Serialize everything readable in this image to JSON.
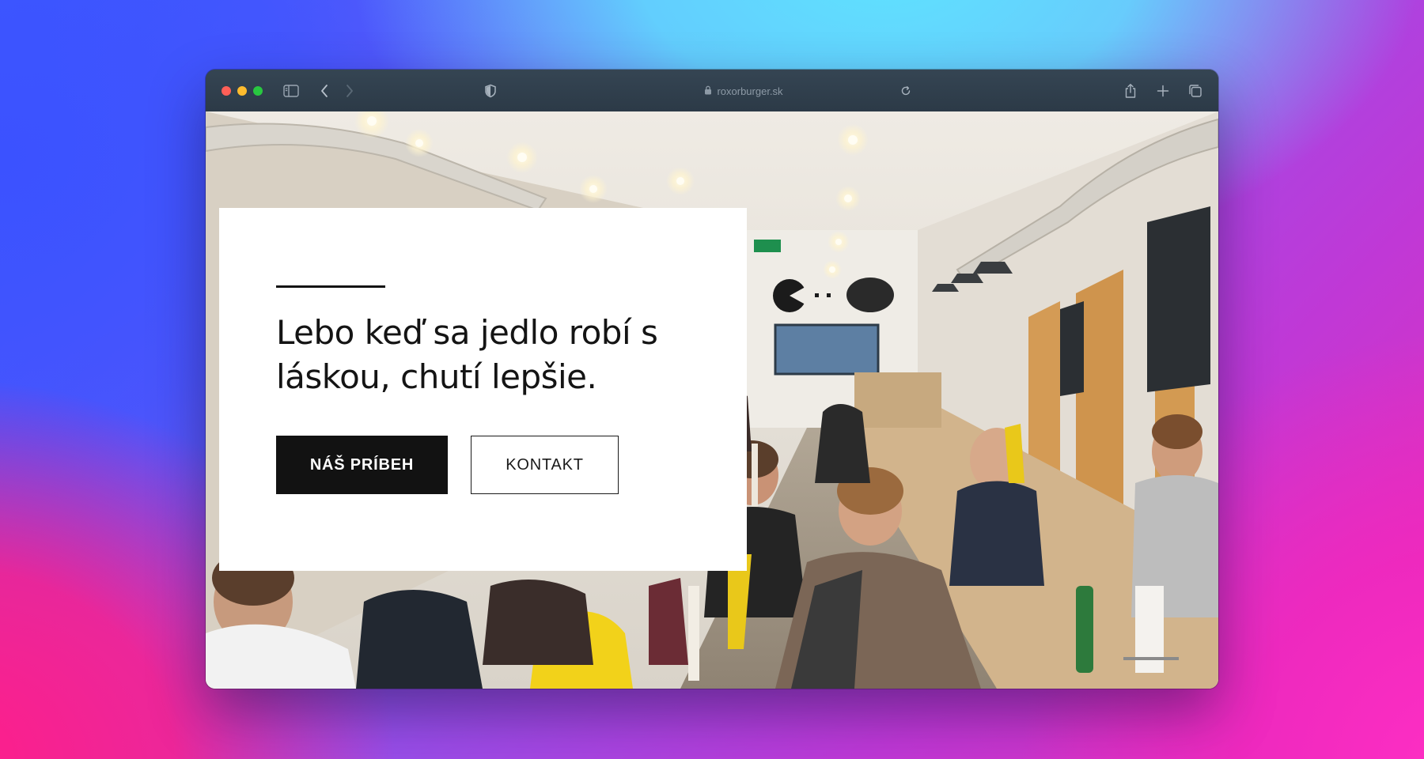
{
  "browser": {
    "address": "roxorburger.sk",
    "icons": {
      "sidebar": "sidebar-icon",
      "back": "chevron-left-icon",
      "forward": "chevron-right-icon",
      "privacy": "shield-icon",
      "lock": "lock-icon",
      "reload": "reload-icon",
      "share": "share-icon",
      "new_tab": "plus-icon",
      "tabs": "tabs-overview-icon"
    }
  },
  "hero": {
    "heading": "Lebo keď sa jedlo robí s láskou, chutí lepšie.",
    "primary_button": "NÁŠ PRÍBEH",
    "secondary_button": "KONTAKT"
  },
  "colors": {
    "window_toolbar": "#2f3d4a",
    "button_primary": "#121212",
    "card": "#ffffff"
  }
}
